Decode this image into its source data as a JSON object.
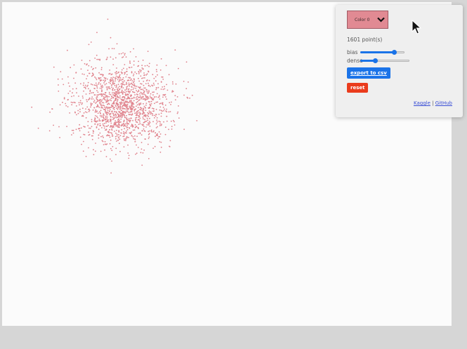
{
  "controls": {
    "color_select": {
      "value": "Color 0",
      "swatch": "#e18a93"
    },
    "point_count": "1601 point(s)",
    "bias": {
      "label": "bias",
      "value": 0.75
    },
    "dense": {
      "label": "dense",
      "value": 0.3
    },
    "export_label": "export to csv",
    "reset_label": "reset",
    "links": {
      "kaggle": "Kaggle",
      "separator": "|",
      "github": "GitHub"
    }
  },
  "icons": {
    "dropdown": "chevron-down-icon",
    "pointer": "mouse-pointer-icon"
  },
  "colors": {
    "point": "#e0828c",
    "accent": "#1a73e8",
    "reset": "#ea3b1c"
  },
  "points": {
    "count": 1601
  }
}
